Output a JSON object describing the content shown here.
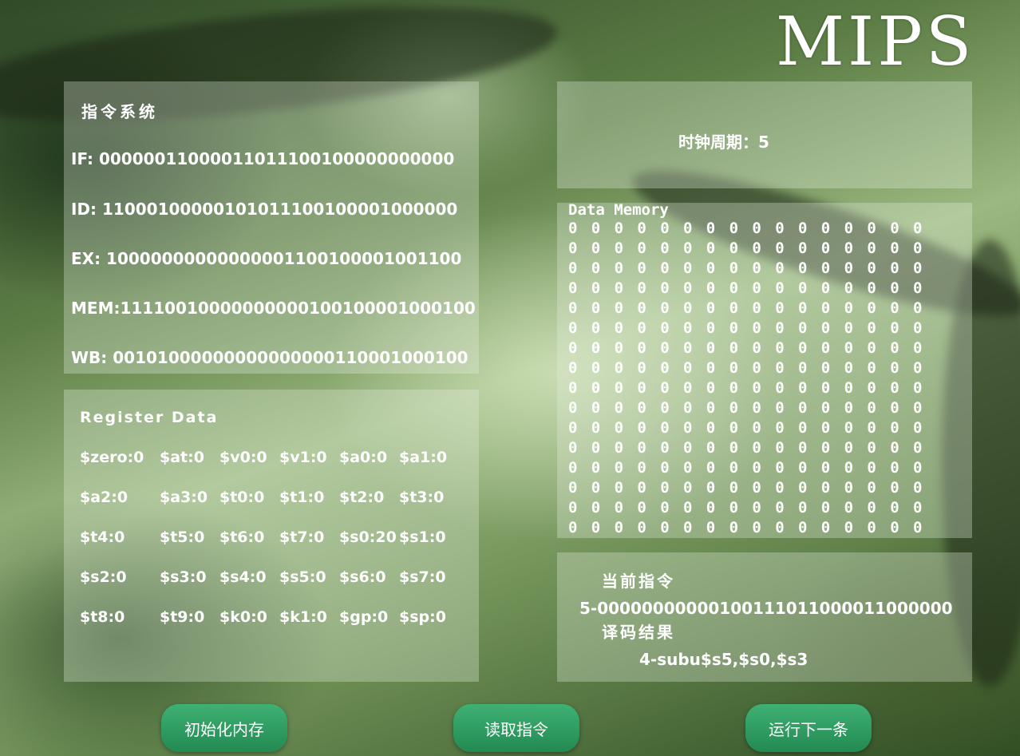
{
  "logo": "MIPS",
  "instruction_panel": {
    "title": "指令系统",
    "stages": [
      {
        "text": "IF: 00000011000011011100100000000000"
      },
      {
        "text": "ID: 11000100000101011100100001000000"
      },
      {
        "text": "EX: 10000000000000001100100001001100"
      },
      {
        "text": "MEM:11110010000000000100100001000100"
      },
      {
        "text": "WB: 00101000000000000000110001000100"
      }
    ]
  },
  "register_panel": {
    "title": "Register Data",
    "rows": [
      [
        "$zero:0",
        "$at:0",
        "$v0:0",
        "$v1:0",
        "$a0:0",
        "$a1:0"
      ],
      [
        "$a2:0",
        "$a3:0",
        "$t0:0",
        "$t1:0",
        "$t2:0",
        "$t3:0"
      ],
      [
        "$t4:0",
        "$t5:0",
        "$t6:0",
        "$t7:0",
        "$s0:20",
        "$s1:0"
      ],
      [
        "$s2:0",
        "$s3:0",
        "$s4:0",
        "$s5:0",
        "$s6:0",
        "$s7:0"
      ],
      [
        "$t8:0",
        "$t9:0",
        "$k0:0",
        "$k1:0",
        "$gp:0",
        "$sp:0"
      ]
    ]
  },
  "clock_panel": {
    "text": "时钟周期：5"
  },
  "memory_panel": {
    "title": "Data Memory",
    "rows": [
      [
        "0",
        "0",
        "0",
        "0",
        "0",
        "0",
        "0",
        "0",
        "0",
        "0",
        "0",
        "0",
        "0",
        "0",
        "0",
        "0"
      ],
      [
        "0",
        "0",
        "0",
        "0",
        "0",
        "0",
        "0",
        "0",
        "0",
        "0",
        "0",
        "0",
        "0",
        "0",
        "0",
        "0"
      ],
      [
        "0",
        "0",
        "0",
        "0",
        "0",
        "0",
        "0",
        "0",
        "0",
        "0",
        "0",
        "0",
        "0",
        "0",
        "0",
        "0"
      ],
      [
        "0",
        "0",
        "0",
        "0",
        "0",
        "0",
        "0",
        "0",
        "0",
        "0",
        "0",
        "0",
        "0",
        "0",
        "0",
        "0"
      ],
      [
        "0",
        "0",
        "0",
        "0",
        "0",
        "0",
        "0",
        "0",
        "0",
        "0",
        "0",
        "0",
        "0",
        "0",
        "0",
        "0"
      ],
      [
        "0",
        "0",
        "0",
        "0",
        "0",
        "0",
        "0",
        "0",
        "0",
        "0",
        "0",
        "0",
        "0",
        "0",
        "0",
        "0"
      ],
      [
        "0",
        "0",
        "0",
        "0",
        "0",
        "0",
        "0",
        "0",
        "0",
        "0",
        "0",
        "0",
        "0",
        "0",
        "0",
        "0"
      ],
      [
        "0",
        "0",
        "0",
        "0",
        "0",
        "0",
        "0",
        "0",
        "0",
        "0",
        "0",
        "0",
        "0",
        "0",
        "0",
        "0"
      ],
      [
        "0",
        "0",
        "0",
        "0",
        "0",
        "0",
        "0",
        "0",
        "0",
        "0",
        "0",
        "0",
        "0",
        "0",
        "0",
        "0"
      ],
      [
        "0",
        "0",
        "0",
        "0",
        "0",
        "0",
        "0",
        "0",
        "0",
        "0",
        "0",
        "0",
        "0",
        "0",
        "0",
        "0"
      ],
      [
        "0",
        "0",
        "0",
        "0",
        "0",
        "0",
        "0",
        "0",
        "0",
        "0",
        "0",
        "0",
        "0",
        "0",
        "0",
        "0"
      ],
      [
        "0",
        "0",
        "0",
        "0",
        "0",
        "0",
        "0",
        "0",
        "0",
        "0",
        "0",
        "0",
        "0",
        "0",
        "0",
        "0"
      ],
      [
        "0",
        "0",
        "0",
        "0",
        "0",
        "0",
        "0",
        "0",
        "0",
        "0",
        "0",
        "0",
        "0",
        "0",
        "0",
        "0"
      ],
      [
        "0",
        "0",
        "0",
        "0",
        "0",
        "0",
        "0",
        "0",
        "0",
        "0",
        "0",
        "0",
        "0",
        "0",
        "0",
        "0"
      ],
      [
        "0",
        "0",
        "0",
        "0",
        "0",
        "0",
        "0",
        "0",
        "0",
        "0",
        "0",
        "0",
        "0",
        "0",
        "0",
        "0"
      ],
      [
        "0",
        "0",
        "0",
        "0",
        "0",
        "0",
        "0",
        "0",
        "0",
        "0",
        "0",
        "0",
        "0",
        "0",
        "0",
        "0"
      ]
    ]
  },
  "current_panel": {
    "title": "当前指令",
    "instruction": "5-00000000000100111011000011000000",
    "decode_title": "译码结果",
    "decode_result": "4-subu$s5,$s0,$s3"
  },
  "buttons": {
    "init_label": "初始化内存",
    "read_label": "读取指令",
    "next_label": "运行下一条"
  },
  "colors": {
    "button": "#2a9a5e",
    "text": "#ffffff"
  }
}
